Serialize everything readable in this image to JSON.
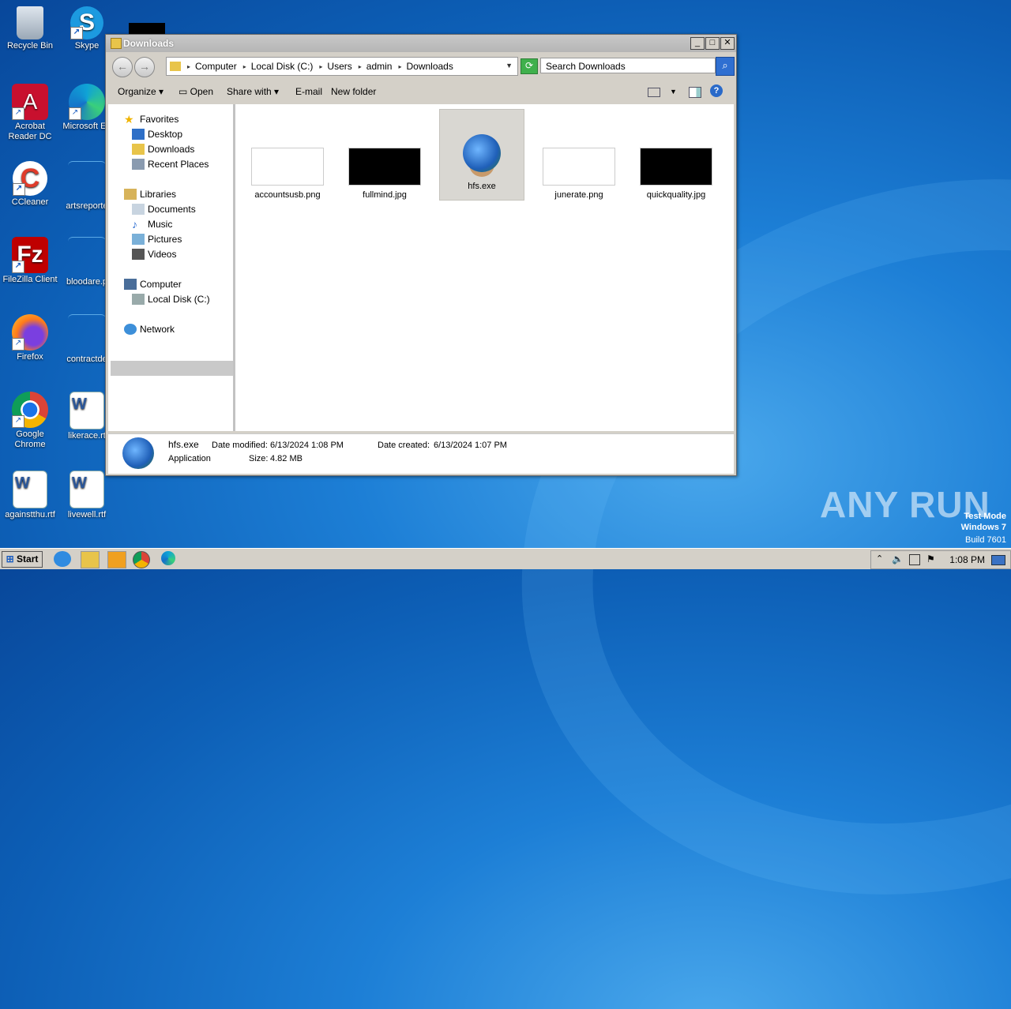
{
  "desktop": {
    "icons": [
      {
        "label": "Recycle Bin"
      },
      {
        "label": "Skype"
      },
      {
        "label": "Acrobat Reader DC"
      },
      {
        "label": "Microsoft Ed"
      },
      {
        "label": "CCleaner"
      },
      {
        "label": "artsreporte"
      },
      {
        "label": "FileZilla Client"
      },
      {
        "label": "bloodare.p"
      },
      {
        "label": "Firefox"
      },
      {
        "label": "contractde"
      },
      {
        "label": "Google Chrome"
      },
      {
        "label": "likerace.rt"
      },
      {
        "label": "againstthu.rtf"
      },
      {
        "label": "livewell.rtf"
      }
    ]
  },
  "window": {
    "title": "Downloads",
    "breadcrumb": [
      "Computer",
      "Local Disk (C:)",
      "Users",
      "admin",
      "Downloads"
    ],
    "search_placeholder": "Search Downloads",
    "toolbar": {
      "organize": "Organize",
      "open": "Open",
      "share": "Share with",
      "email": "E-mail",
      "newfolder": "New folder"
    },
    "nav": {
      "favorites": "Favorites",
      "desktop": "Desktop",
      "downloads": "Downloads",
      "recent": "Recent Places",
      "libraries": "Libraries",
      "documents": "Documents",
      "music": "Music",
      "pictures": "Pictures",
      "videos": "Videos",
      "computer": "Computer",
      "localdisk": "Local Disk (C:)",
      "network": "Network"
    },
    "files": [
      {
        "name": "accountsusb.png"
      },
      {
        "name": "fullmind.jpg"
      },
      {
        "name": "hfs.exe"
      },
      {
        "name": "junerate.png"
      },
      {
        "name": "quickquality.jpg"
      }
    ],
    "details": {
      "name": "hfs.exe",
      "type": "Application",
      "modified_label": "Date modified:",
      "modified": "6/13/2024 1:08 PM",
      "created_label": "Date created:",
      "created": "6/13/2024 1:07 PM",
      "size_label": "Size:",
      "size": "4.82 MB"
    }
  },
  "taskbar": {
    "start": "Start",
    "clock": "1:08 PM"
  },
  "watermark": {
    "brand": "ANY RUN",
    "mode": "Test Mode",
    "os": "Windows 7",
    "build": "Build 7601"
  }
}
